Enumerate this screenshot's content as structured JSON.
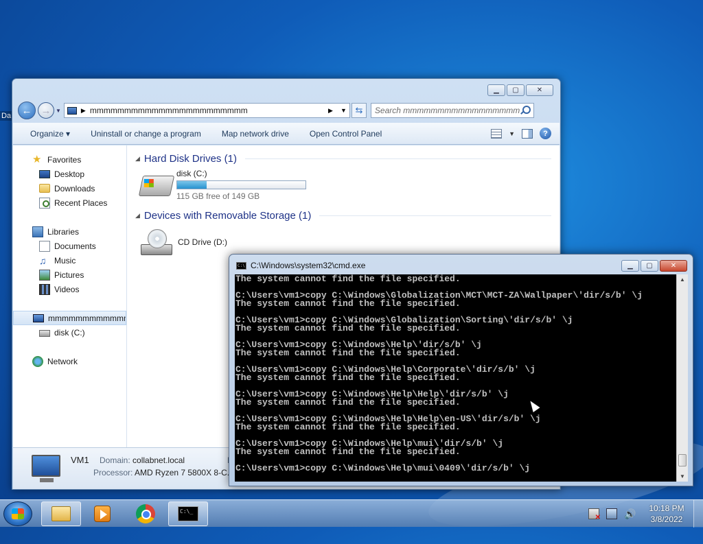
{
  "desktop": {
    "partial_label": "Da"
  },
  "explorer": {
    "address": {
      "crumb": "mmmmmmmmmmmmmmmmmmmmmmm"
    },
    "search": {
      "placeholder": "Search mmmmmmmmmmmmmmmmmm..."
    },
    "toolbar": {
      "organize": "Organize ▾",
      "uninstall": "Uninstall or change a program",
      "map_drive": "Map network drive",
      "control_panel": "Open Control Panel"
    },
    "nav": {
      "favorites": "Favorites",
      "desktop": "Desktop",
      "downloads": "Downloads",
      "recent": "Recent Places",
      "libraries": "Libraries",
      "documents": "Documents",
      "music": "Music",
      "pictures": "Pictures",
      "videos": "Videos",
      "computer": "mmmmmmmmmmmmmmmm",
      "disk_c": "disk (C:)",
      "network": "Network"
    },
    "groups": {
      "hdd_header": "Hard Disk Drives (1)",
      "removable_header": "Devices with Removable Storage (1)"
    },
    "drives": {
      "c_name": "disk (C:)",
      "c_free": "115 GB free of 149 GB",
      "c_used_fraction": 0.23,
      "d_name": "CD Drive (D:)"
    },
    "details": {
      "name": "VM1",
      "domain_label": "Domain:",
      "domain_value": "collabnet.local",
      "processor_label": "Processor:",
      "processor_value": "AMD Ryzen 7 5800X 8-C...",
      "extra_label": "M"
    }
  },
  "cmd": {
    "title": "C:\\Windows\\system32\\cmd.exe",
    "lines": [
      "The system cannot find the file specified.",
      "",
      "C:\\Users\\vm1>copy C:\\Windows\\Globalization\\MCT\\MCT-ZA\\Wallpaper\\'dir/s/b' \\j",
      "The system cannot find the file specified.",
      "",
      "C:\\Users\\vm1>copy C:\\Windows\\Globalization\\Sorting\\'dir/s/b' \\j",
      "The system cannot find the file specified.",
      "",
      "C:\\Users\\vm1>copy C:\\Windows\\Help\\'dir/s/b' \\j",
      "The system cannot find the file specified.",
      "",
      "C:\\Users\\vm1>copy C:\\Windows\\Help\\Corporate\\'dir/s/b' \\j",
      "The system cannot find the file specified.",
      "",
      "C:\\Users\\vm1>copy C:\\Windows\\Help\\Help\\'dir/s/b' \\j",
      "The system cannot find the file specified.",
      "",
      "C:\\Users\\vm1>copy C:\\Windows\\Help\\Help\\en-US\\'dir/s/b' \\j",
      "The system cannot find the file specified.",
      "",
      "C:\\Users\\vm1>copy C:\\Windows\\Help\\mui\\'dir/s/b' \\j",
      "The system cannot find the file specified.",
      "",
      "C:\\Users\\vm1>copy C:\\Windows\\Help\\mui\\0409\\'dir/s/b' \\j"
    ]
  },
  "taskbar": {
    "time": "10:18 PM",
    "date": "3/8/2022"
  },
  "colors": {
    "desktop_bg": "#0f5cb8",
    "console_bg": "#000000",
    "console_text": "#c0c0c0",
    "group_header": "#1e3287"
  }
}
